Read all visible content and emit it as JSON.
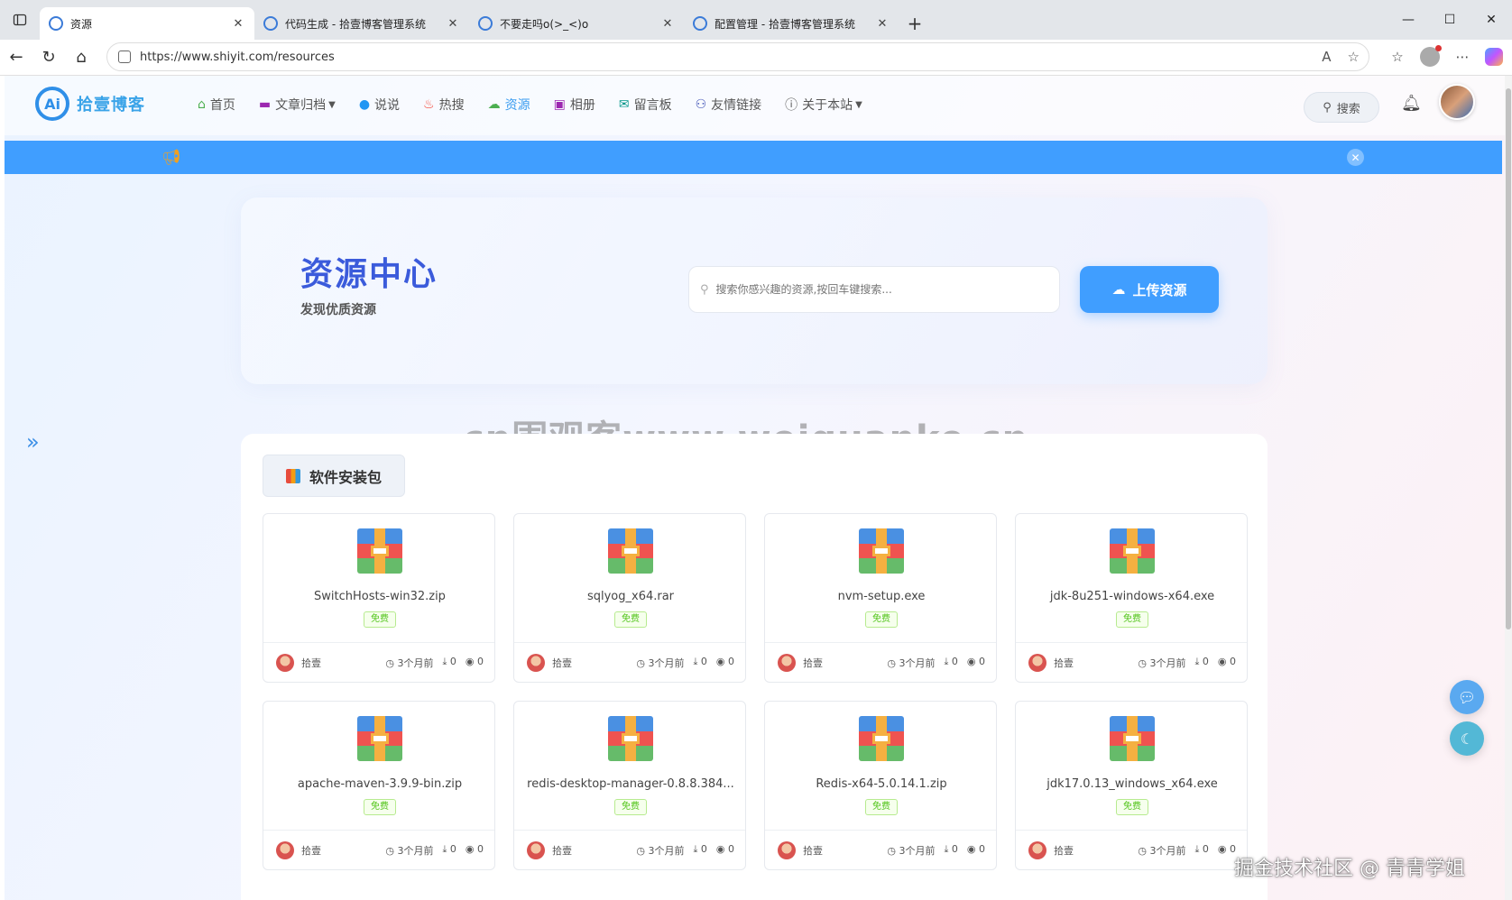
{
  "browser": {
    "tabs": [
      {
        "title": "资源",
        "active": true
      },
      {
        "title": "代码生成 - 拾壹博客管理系统",
        "active": false
      },
      {
        "title": "不要走吗o(>_<)o",
        "active": false
      },
      {
        "title": "配置管理 - 拾壹博客管理系统",
        "active": false
      }
    ],
    "url": "https://www.shiyit.com/resources"
  },
  "site": {
    "logo_text": "拾壹博客",
    "menu": [
      {
        "label": "首页",
        "icon": "home-icon",
        "color": "#4caf50"
      },
      {
        "label": "文章归档",
        "icon": "archive-icon",
        "color": "#9c27b0",
        "dropdown": true
      },
      {
        "label": "说说",
        "icon": "chat-icon",
        "color": "#2196f3"
      },
      {
        "label": "热搜",
        "icon": "fire-icon",
        "color": "#f44336"
      },
      {
        "label": "资源",
        "icon": "cloud-icon",
        "color": "#4caf50",
        "active": true
      },
      {
        "label": "相册",
        "icon": "image-icon",
        "color": "#9c27b0"
      },
      {
        "label": "留言板",
        "icon": "mail-icon",
        "color": "#009688"
      },
      {
        "label": "友情链接",
        "icon": "users-icon",
        "color": "#3f51b5"
      },
      {
        "label": "关于本站",
        "icon": "info-icon",
        "color": "#555555",
        "dropdown": true
      }
    ],
    "search_label": "搜索"
  },
  "hero": {
    "title": "资源中心",
    "subtitle": "发现优质资源",
    "search_placeholder": "搜索你感兴趣的资源,按回车键搜索...",
    "upload_label": "上传资源"
  },
  "watermark": "cn围观客www.weiguanke.cn",
  "category": {
    "label": "软件安装包"
  },
  "resources": [
    {
      "name": "SwitchHosts-win32.zip",
      "badge": "免费",
      "author": "拾壹",
      "time": "3个月前",
      "downloads": "0",
      "views": "0"
    },
    {
      "name": "sqlyog_x64.rar",
      "badge": "免费",
      "author": "拾壹",
      "time": "3个月前",
      "downloads": "0",
      "views": "0"
    },
    {
      "name": "nvm-setup.exe",
      "badge": "免费",
      "author": "拾壹",
      "time": "3个月前",
      "downloads": "0",
      "views": "0"
    },
    {
      "name": "jdk-8u251-windows-x64.exe",
      "badge": "免费",
      "author": "拾壹",
      "time": "3个月前",
      "downloads": "0",
      "views": "0"
    },
    {
      "name": "apache-maven-3.9.9-bin.zip",
      "badge": "免费",
      "author": "拾壹",
      "time": "3个月前",
      "downloads": "0",
      "views": "0"
    },
    {
      "name": "redis-desktop-manager-0.8.8.384...",
      "badge": "免费",
      "author": "拾壹",
      "time": "3个月前",
      "downloads": "0",
      "views": "0"
    },
    {
      "name": "Redis-x64-5.0.14.1.zip",
      "badge": "免费",
      "author": "拾壹",
      "time": "3个月前",
      "downloads": "0",
      "views": "0"
    },
    {
      "name": "jdk17.0.13_windows_x64.exe",
      "badge": "免费",
      "author": "拾壹",
      "time": "3个月前",
      "downloads": "0",
      "views": "0"
    }
  ],
  "credit": "掘金技术社区 @ 青青学姐",
  "colors": {
    "accent": "#409eff",
    "title": "#3b5bdb"
  }
}
